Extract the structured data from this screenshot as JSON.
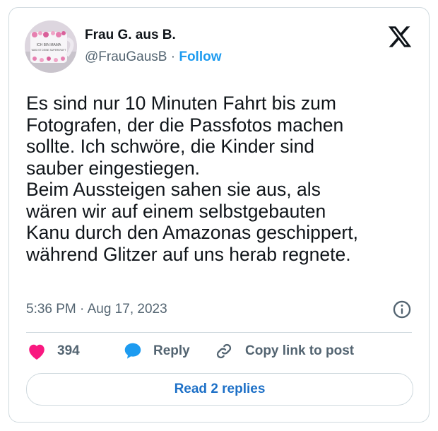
{
  "author": {
    "display_name": "Frau G. aus B.",
    "handle": "@FrauGausB",
    "separator": "·",
    "follow_label": "Follow",
    "avatar_mug_text_line1": "ICH BIN MAMA",
    "avatar_mug_text_line2": "WAS IST DEINE SUPERKRAFT"
  },
  "tweet": {
    "text": "Es sind nur 10 Minuten Fahrt bis zum\nFotografen, der die Passfotos machen\nsollte. Ich schwöre, die Kinder sind\nsauber eingestiegen.\nBeim Aussteigen sahen sie aus, als\nwären wir auf einem selbstgebauten\nKanu durch den Amazonas geschippert,\nwährend Glitzer auf uns herab regnete.",
    "timestamp": "5:36 PM · Aug 17, 2023"
  },
  "actions": {
    "like_count": "394",
    "reply_label": "Reply",
    "copy_label": "Copy link to post"
  },
  "read_replies_label": "Read 2 replies",
  "icons": {
    "brand": "x-logo-icon",
    "info": "info-icon",
    "like": "heart-icon",
    "reply": "reply-bubble-icon",
    "copy": "link-icon"
  },
  "colors": {
    "link_blue": "#1d9bf0",
    "replies_blue": "#1d70c7",
    "heart_pink": "#f91880",
    "secondary_text": "#536471",
    "border": "#cfd9de"
  }
}
